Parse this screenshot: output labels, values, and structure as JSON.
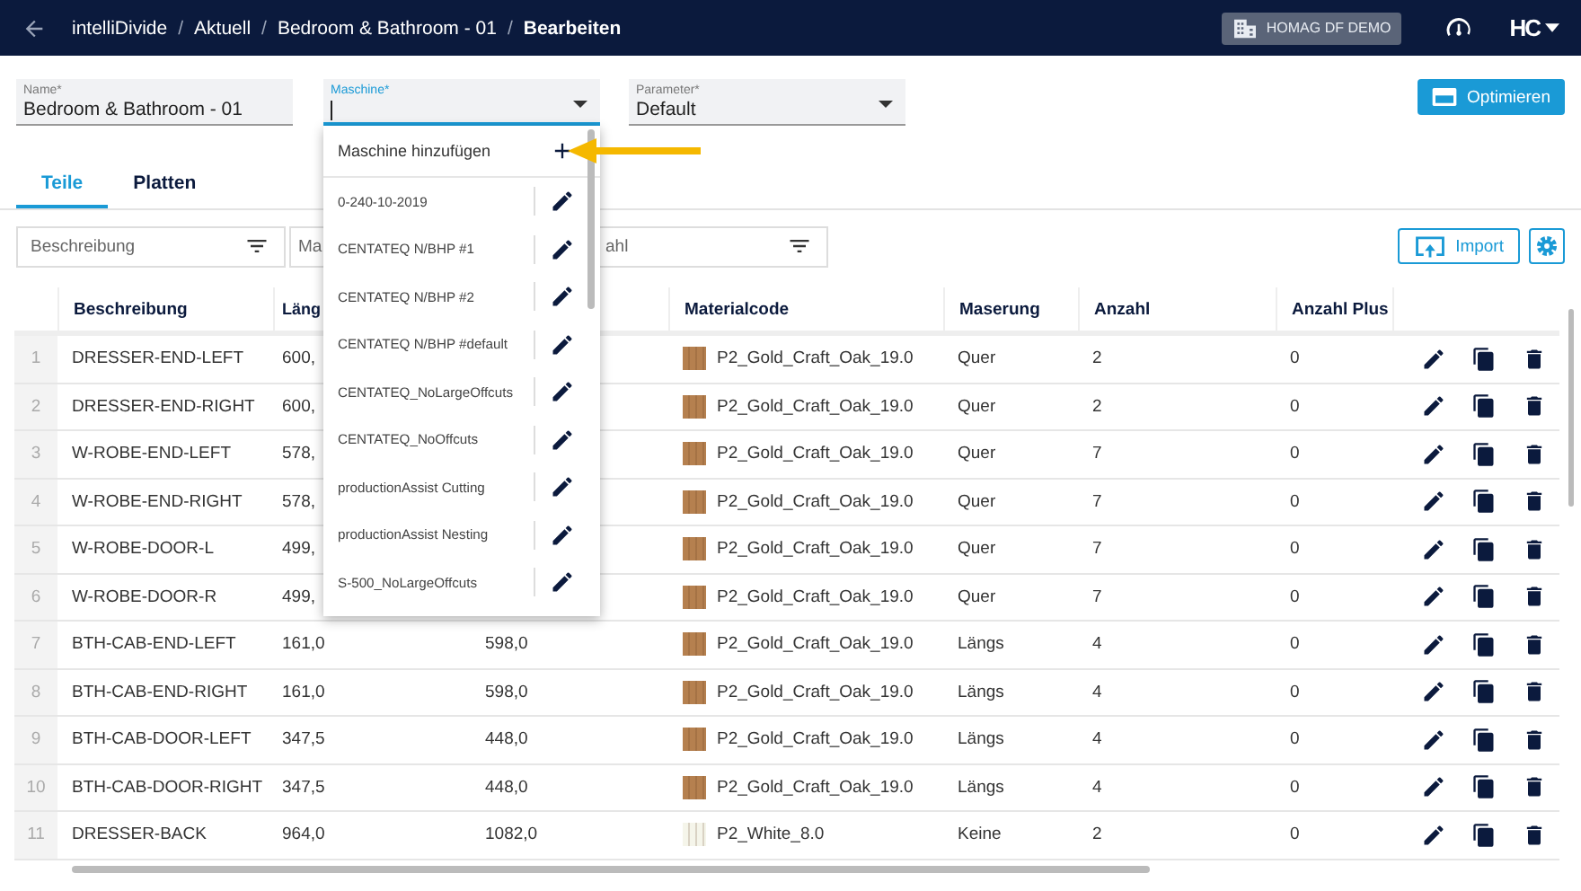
{
  "header": {
    "breadcrumbs": [
      "intelliDivide",
      "Aktuell",
      "Bedroom & Bathroom - 01",
      "Bearbeiten"
    ],
    "separators": [
      "/",
      "/",
      "/"
    ],
    "tenant": "HOMAG DF DEMO",
    "logo": "HC"
  },
  "form": {
    "fields": [
      {
        "kind": "text",
        "label": "Name*",
        "value": "Bedroom & Bathroom - 01",
        "focused": false
      },
      {
        "kind": "select",
        "label": "Maschine*",
        "focused": true
      },
      {
        "kind": "select",
        "label": "Parameter*",
        "value": "Default",
        "focused": false
      }
    ],
    "optimize_button": "Optimieren"
  },
  "tabs": [
    {
      "label": "Teile",
      "selected": true
    },
    {
      "label": "Platten",
      "selected": false
    }
  ],
  "filters": [
    {
      "placeholder": "Beschreibung",
      "filter_icon": true
    },
    {
      "placeholder": "Ma",
      "filter_icon": false
    },
    {
      "placeholder": "ahl",
      "filter_icon": true
    }
  ],
  "import_button": "Import",
  "table": {
    "columns": {
      "beschreibung": "Beschreibung",
      "laenge": "Läng",
      "materialcode": "Materialcode",
      "maserung": "Maserung",
      "anzahl": "Anzahl",
      "anzahl_plus": "Anzahl Plus"
    },
    "rows": [
      {
        "index": "1",
        "beschreibung": "DRESSER-END-LEFT",
        "laenge": "600,",
        "materialcode": "P2_Gold_Craft_Oak_19.0",
        "color": "#b5804f",
        "maserung": "Quer",
        "anzahl": "2",
        "anzahl_plus": "0"
      },
      {
        "index": "2",
        "beschreibung": "DRESSER-END-RIGHT",
        "laenge": "600,",
        "materialcode": "P2_Gold_Craft_Oak_19.0",
        "color": "#b5804f",
        "maserung": "Quer",
        "anzahl": "2",
        "anzahl_plus": "0"
      },
      {
        "index": "3",
        "beschreibung": "W-ROBE-END-LEFT",
        "laenge": "578,",
        "materialcode": "P2_Gold_Craft_Oak_19.0",
        "color": "#b5804f",
        "maserung": "Quer",
        "anzahl": "7",
        "anzahl_plus": "0"
      },
      {
        "index": "4",
        "beschreibung": "W-ROBE-END-RIGHT",
        "laenge": "578,",
        "materialcode": "P2_Gold_Craft_Oak_19.0",
        "color": "#b5804f",
        "maserung": "Quer",
        "anzahl": "7",
        "anzahl_plus": "0"
      },
      {
        "index": "5",
        "beschreibung": "W-ROBE-DOOR-L",
        "laenge": "499,",
        "materialcode": "P2_Gold_Craft_Oak_19.0",
        "color": "#b5804f",
        "maserung": "Quer",
        "anzahl": "7",
        "anzahl_plus": "0"
      },
      {
        "index": "6",
        "beschreibung": "W-ROBE-DOOR-R",
        "laenge": "499,",
        "materialcode": "P2_Gold_Craft_Oak_19.0",
        "color": "#b5804f",
        "maserung": "Quer",
        "anzahl": "7",
        "anzahl_plus": "0"
      },
      {
        "index": "7",
        "beschreibung": "BTH-CAB-END-LEFT",
        "laenge": "161,0",
        "column_3": "598,0",
        "materialcode": "P2_Gold_Craft_Oak_19.0",
        "color": "#b5804f",
        "maserung": "Längs",
        "anzahl": "4",
        "anzahl_plus": "0"
      },
      {
        "index": "8",
        "beschreibung": "BTH-CAB-END-RIGHT",
        "laenge": "161,0",
        "column_3": "598,0",
        "materialcode": "P2_Gold_Craft_Oak_19.0",
        "color": "#b5804f",
        "maserung": "Längs",
        "anzahl": "4",
        "anzahl_plus": "0"
      },
      {
        "index": "9",
        "beschreibung": "BTH-CAB-DOOR-LEFT",
        "laenge": "347,5",
        "column_3": "448,0",
        "materialcode": "P2_Gold_Craft_Oak_19.0",
        "color": "#b5804f",
        "maserung": "Längs",
        "anzahl": "4",
        "anzahl_plus": "0"
      },
      {
        "index": "10",
        "beschreibung": "BTH-CAB-DOOR-RIGHT",
        "laenge": "347,5",
        "column_3": "448,0",
        "materialcode": "P2_Gold_Craft_Oak_19.0",
        "color": "#b5804f",
        "maserung": "Längs",
        "anzahl": "4",
        "anzahl_plus": "0"
      },
      {
        "index": "11",
        "beschreibung": "DRESSER-BACK",
        "laenge": "964,0",
        "column_3": "1082,0",
        "materialcode": "P2_White_8.0",
        "color": "#f5f5ea",
        "maserung": "Keine",
        "anzahl": "2",
        "anzahl_plus": "0"
      }
    ]
  },
  "dropdown": {
    "items": [
      {
        "kind": "add",
        "label": "Maschine hinzufügen"
      },
      {
        "kind": "machine",
        "label": "0-240-10-2019"
      },
      {
        "kind": "machine",
        "label": "CENTATEQ N/BHP #1"
      },
      {
        "kind": "machine",
        "label": "CENTATEQ N/BHP #2"
      },
      {
        "kind": "machine",
        "label": "CENTATEQ N/BHP #default"
      },
      {
        "kind": "machine",
        "label": "CENTATEQ_NoLargeOffcuts"
      },
      {
        "kind": "machine",
        "label": "CENTATEQ_NoOffcuts"
      },
      {
        "kind": "machine",
        "label": "productionAssist Cutting"
      },
      {
        "kind": "machine",
        "label": "productionAssist Nesting"
      },
      {
        "kind": "machine",
        "label": "S-500_NoLargeOffcuts"
      }
    ]
  }
}
